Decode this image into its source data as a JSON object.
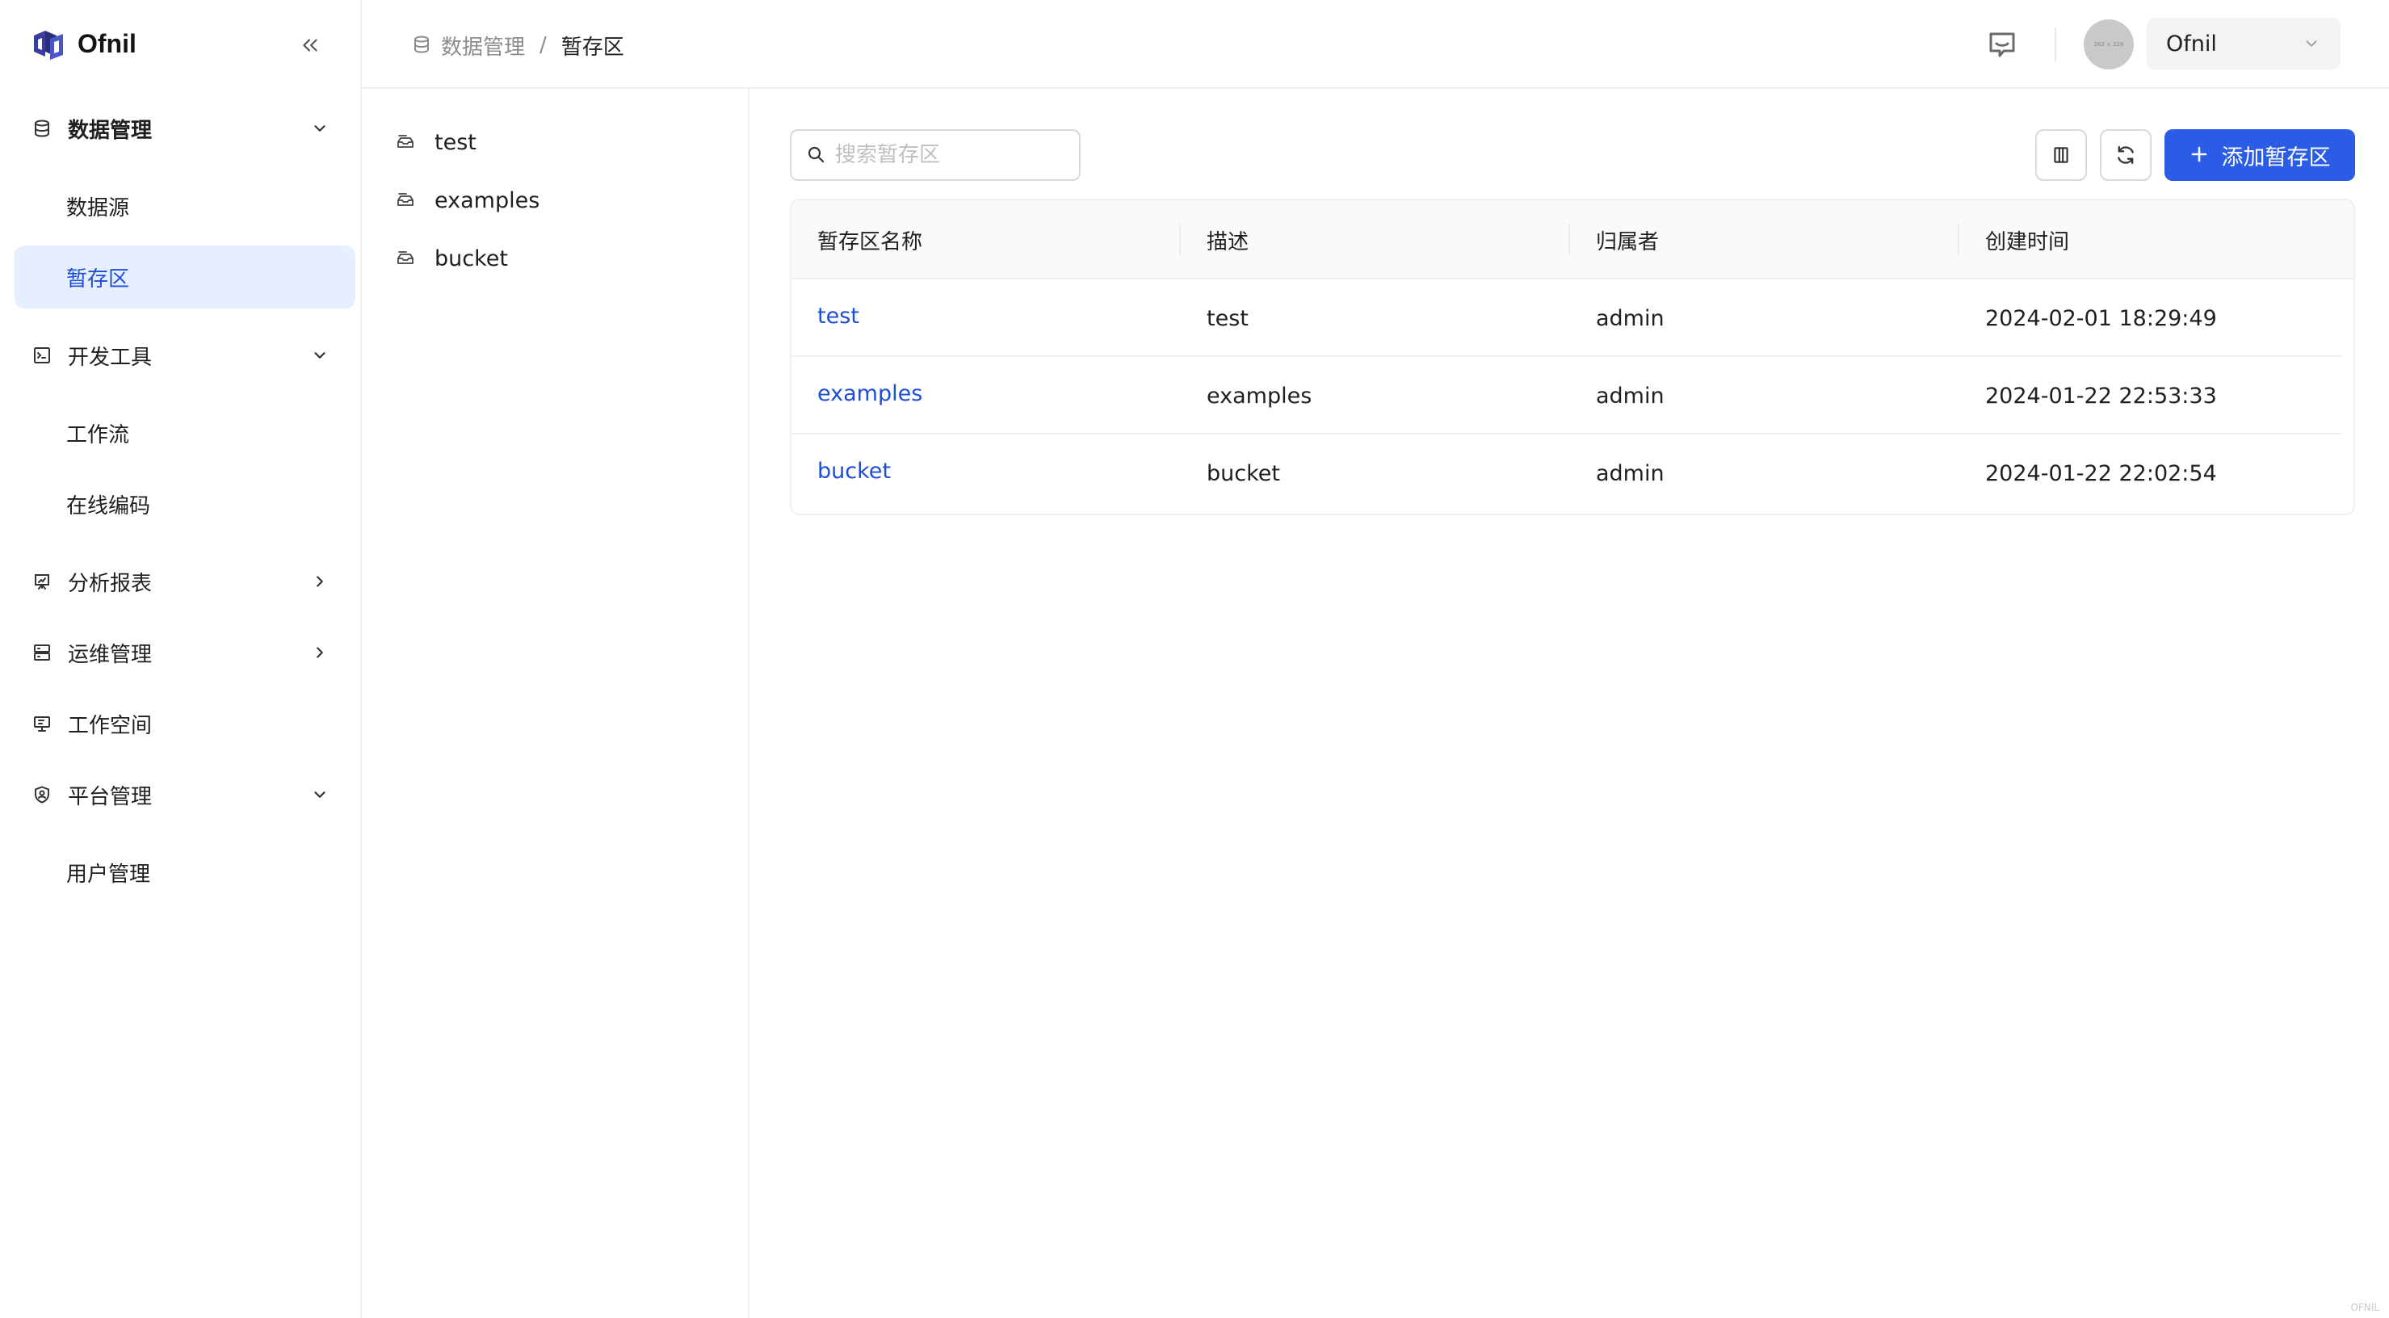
{
  "brand": {
    "name": "Ofnil"
  },
  "sidebar": {
    "groups": [
      {
        "label": "数据管理",
        "icon": "database-icon",
        "expanded": true,
        "items": [
          {
            "label": "数据源"
          },
          {
            "label": "暂存区",
            "active": true
          }
        ]
      },
      {
        "label": "开发工具",
        "icon": "terminal-icon",
        "expanded": true,
        "items": [
          {
            "label": "工作流"
          },
          {
            "label": "在线编码"
          }
        ]
      },
      {
        "label": "分析报表",
        "icon": "presentation-chart-icon",
        "expanded": false
      },
      {
        "label": "运维管理",
        "icon": "server-icon",
        "expanded": false
      },
      {
        "label": "工作空间",
        "icon": "monitor-icon"
      },
      {
        "label": "平台管理",
        "icon": "shield-icon",
        "expanded": true,
        "items": [
          {
            "label": "用户管理"
          }
        ]
      }
    ]
  },
  "header": {
    "breadcrumb": [
      "数据管理",
      "暂存区"
    ],
    "breadcrumb_separator": "/",
    "avatar_text": "262 × 228",
    "user": "Ofnil"
  },
  "bucket_list": [
    "test",
    "examples",
    "bucket"
  ],
  "main": {
    "search_placeholder": "搜索暂存区",
    "add_button": "添加暂存区",
    "table": {
      "columns": [
        "暂存区名称",
        "描述",
        "归属者",
        "创建时间"
      ],
      "rows": [
        [
          "test",
          "test",
          "admin",
          "2024-02-01 18:29:49"
        ],
        [
          "examples",
          "examples",
          "admin",
          "2024-01-22 22:53:33"
        ],
        [
          "bucket",
          "bucket",
          "admin",
          "2024-01-22 22:02:54"
        ]
      ]
    }
  },
  "watermark": "OFNIL",
  "colors": {
    "primary": "#2b5ce6",
    "link": "#1d4ed8",
    "active_bg": "#e6efff"
  }
}
